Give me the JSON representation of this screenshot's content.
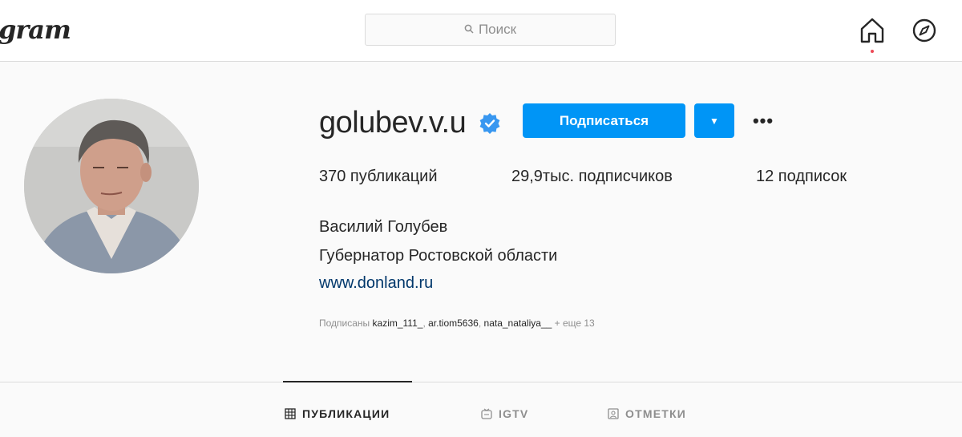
{
  "nav": {
    "logo_text": "gram",
    "search_placeholder": "Поиск",
    "icons": {
      "search": "search-icon",
      "home": "home-icon",
      "explore": "compass-icon"
    }
  },
  "profile": {
    "username": "golubev.v.u",
    "verified": true,
    "follow_label": "Подписаться",
    "stats": {
      "posts": "370 публикаций",
      "followers": "29,9тыс. подписчиков",
      "following": "12 подписок"
    },
    "full_name": "Василий Голубев",
    "bio": "Губернатор Ростовской области",
    "website": "www.donland.ru",
    "followed_by": {
      "prefix": "Подписаны",
      "users": [
        "kazim_111_",
        "ar.tiom5636",
        "nata_nataliya__"
      ],
      "more": "+ еще 13"
    }
  },
  "tabs": [
    {
      "label": "ПУБЛИКАЦИИ",
      "icon": "grid-icon",
      "active": true
    },
    {
      "label": "IGTV",
      "icon": "igtv-icon",
      "active": false
    },
    {
      "label": "ОТМЕТКИ",
      "icon": "tagged-icon",
      "active": false
    }
  ],
  "colors": {
    "accent": "#0095f6",
    "verified": "#3897f0",
    "link": "#00376b"
  }
}
